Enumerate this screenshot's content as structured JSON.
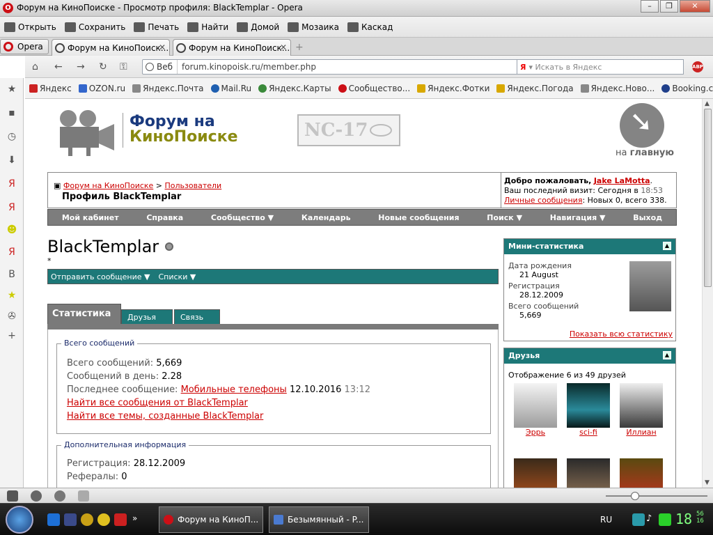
{
  "window": {
    "title": "Форум на КиноПоиске - Просмотр профиля: BlackTemplar - Opera"
  },
  "menubar": [
    {
      "label": "Открыть",
      "icon": "folder-icon"
    },
    {
      "label": "Сохранить",
      "icon": "save-icon"
    },
    {
      "label": "Печать",
      "icon": "print-icon"
    },
    {
      "label": "Найти",
      "icon": "find-icon"
    },
    {
      "label": "Домой",
      "icon": "home-icon"
    },
    {
      "label": "Мозаика",
      "icon": "tile-icon"
    },
    {
      "label": "Каскад",
      "icon": "cascade-icon"
    }
  ],
  "tabs": {
    "opera_menu": "Opera",
    "items": [
      {
        "label": "Форум на КиноПоиск..."
      },
      {
        "label": "Форум на КиноПоиск..."
      }
    ]
  },
  "address": {
    "web_label": "Веб",
    "url": "forum.kinopoisk.ru/member.php",
    "search_placeholder": "Искать в Яндекс",
    "search_engine": "Я"
  },
  "bookmarks": [
    {
      "label": "Яндекс",
      "color": "#cc2222"
    },
    {
      "label": "OZON.ru",
      "color": "#3366cc"
    },
    {
      "label": "Яндекс.Почта",
      "color": "#888888"
    },
    {
      "label": "Mail.Ru",
      "color": "#1f5fb0"
    },
    {
      "label": "Яндекс.Карты",
      "color": "#3a8a3a"
    },
    {
      "label": "Сообщество...",
      "color": "#cc0f16"
    },
    {
      "label": "Яндекс.Фотки",
      "color": "#d8a800"
    },
    {
      "label": "Яндекс.Погода",
      "color": "#d8a800"
    },
    {
      "label": "Яндекс.Ново...",
      "color": "#888888"
    },
    {
      "label": "Booking.com",
      "color": "#1f3f8a"
    }
  ],
  "site": {
    "name_line1": "Форум на",
    "name_line2": "КиноПоиске",
    "rating": "NC-17",
    "home_prefix": "на ",
    "home_bold": "главную"
  },
  "breadcrumb": {
    "root": "Форум на КиноПоиске",
    "sep": ">",
    "section": "Пользователи",
    "current": "Профиль BlackTemplar"
  },
  "welcome": {
    "greeting": "Добро пожаловать,",
    "user": "Jake LaMotta",
    "last_visit_label": "Ваш последний визит: Сегодня в",
    "last_visit_time": "18:53",
    "pm_link": "Личные сообщения",
    "pm_info": ": Новых 0, всего 338."
  },
  "navbar": [
    "Мой кабинет",
    "Справка",
    "Сообщество ▼",
    "Календарь",
    "Новые сообщения",
    "Поиск ▼",
    "Навигация ▼",
    "Выход"
  ],
  "profile": {
    "name": "BlackTemplar",
    "subtitle": "*",
    "actions": [
      "Отправить сообщение ▼",
      "Списки ▼"
    ]
  },
  "profile_tabs": [
    "Статистика",
    "Друзья",
    "Связь"
  ],
  "stats": {
    "legend": "Всего сообщений",
    "total_label": "Всего сообщений:",
    "total_value": "5,669",
    "per_day_label": "Сообщений в день:",
    "per_day_value": "2.28",
    "last_label": "Последнее сообщение:",
    "last_link": "Мобильные телефоны",
    "last_date": "12.10.2016",
    "last_time": "13:12",
    "find_posts": "Найти все сообщения от BlackTemplar",
    "find_threads": "Найти все темы, созданные BlackTemplar"
  },
  "extra": {
    "legend": "Дополнительная информация",
    "reg_label": "Регистрация:",
    "reg_value": "28.12.2009",
    "ref_label": "Рефералы:",
    "ref_value": "0"
  },
  "mini_stats": {
    "title": "Мини-статистика",
    "birthday_label": "Дата рождения",
    "birthday_value": "21 August",
    "reg_label": "Регистрация",
    "reg_value": "28.12.2009",
    "posts_label": "Всего сообщений",
    "posts_value": "5,669",
    "show_all": "Показать всю статистику"
  },
  "friends": {
    "title": "Друзья",
    "showing": "Отображение 6 из 49 друзей",
    "list": [
      {
        "name": "Эррь"
      },
      {
        "name": "sci-fi"
      },
      {
        "name": "Иллиан"
      }
    ]
  },
  "taskbar": {
    "tasks": [
      "Форум на КиноП...",
      "Безымянный - P..."
    ],
    "lang": "RU",
    "clock_hour": "18",
    "clock_min": "56",
    "clock_sec": "16"
  },
  "colors": {
    "accent_teal": "#1d7878",
    "nav_grey": "#7d7d7d",
    "link_red": "#cc0000"
  }
}
